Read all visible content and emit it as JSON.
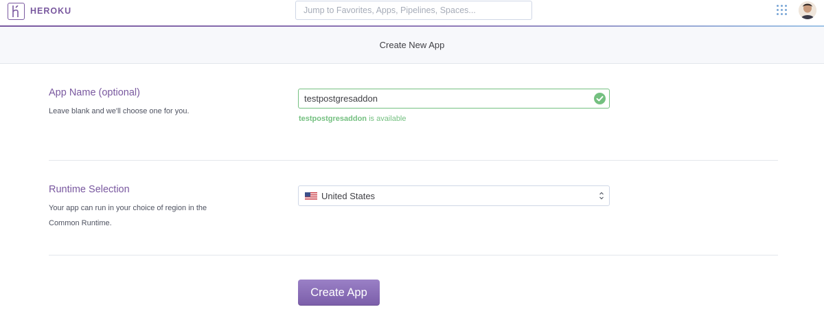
{
  "brand": {
    "name": "HEROKU",
    "accent": "#79589f"
  },
  "search": {
    "placeholder": "Jump to Favorites, Apps, Pipelines, Spaces..."
  },
  "header": {
    "apps_menu_icon": "apps-grid-icon",
    "avatar": "user-avatar"
  },
  "page": {
    "title": "Create New App"
  },
  "app_name": {
    "label": "App Name (optional)",
    "description": "Leave blank and we'll choose one for you.",
    "value": "testpostgresaddon",
    "availability_name": "testpostgresaddon",
    "availability_suffix": " is available",
    "status_color": "#74c080"
  },
  "runtime": {
    "label": "Runtime Selection",
    "description_line1": "Your app can run in your choice of region in the",
    "description_line2": "Common Runtime.",
    "selected_region": "United States",
    "flag_icon": "us-flag-icon"
  },
  "actions": {
    "create_label": "Create App"
  }
}
